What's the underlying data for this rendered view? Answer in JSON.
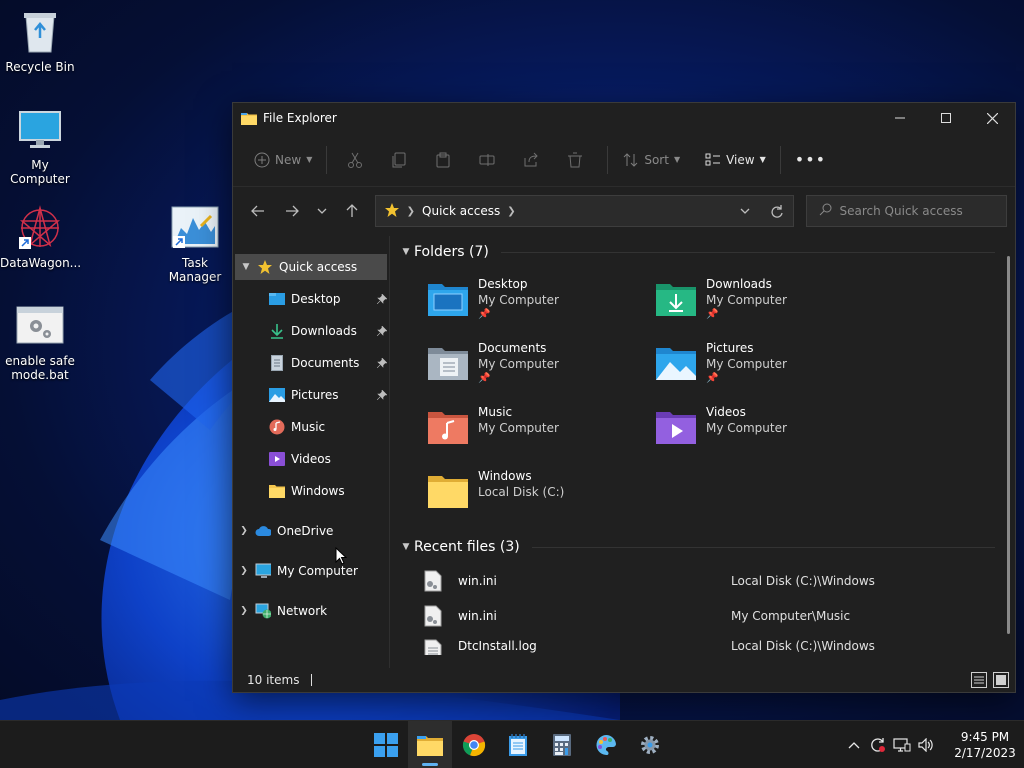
{
  "desktop": {
    "icons": [
      {
        "label": "Recycle Bin"
      },
      {
        "label": "My Computer"
      },
      {
        "label": "DataWagon..."
      },
      {
        "label": "Task Manager"
      },
      {
        "label": "enable safe mode.bat"
      }
    ]
  },
  "window": {
    "title": "File Explorer",
    "toolbar": {
      "new_label": "New",
      "sort_label": "Sort",
      "view_label": "View"
    },
    "address": {
      "crumb": "Quick access"
    },
    "search_placeholder": "Search Quick access",
    "sidebar": {
      "quick_access": "Quick access",
      "pinned": [
        "Desktop",
        "Downloads",
        "Documents",
        "Pictures"
      ],
      "others": [
        "Music",
        "Videos",
        "Windows"
      ],
      "onedrive": "OneDrive",
      "my_computer": "My Computer",
      "network": "Network"
    },
    "folders_header": "Folders (7)",
    "folders": [
      {
        "name": "Desktop",
        "loc": "My Computer"
      },
      {
        "name": "Downloads",
        "loc": "My Computer"
      },
      {
        "name": "Documents",
        "loc": "My Computer"
      },
      {
        "name": "Pictures",
        "loc": "My Computer"
      },
      {
        "name": "Music",
        "loc": "My Computer"
      },
      {
        "name": "Videos",
        "loc": "My Computer"
      },
      {
        "name": "Windows",
        "loc": "Local Disk (C:)"
      }
    ],
    "recent_header": "Recent files (3)",
    "recent": [
      {
        "name": "win.ini",
        "path": "Local Disk (C:)\\Windows"
      },
      {
        "name": "win.ini",
        "path": "My Computer\\Music"
      },
      {
        "name": "DtcInstall.log",
        "path": "Local Disk (C:)\\Windows"
      }
    ],
    "status": "10 items"
  },
  "taskbar": {
    "time": "9:45 PM",
    "date": "2/17/2023"
  },
  "colors": {
    "accent": "#5fb2f2",
    "window_bg": "#202020",
    "selection": "#4a4a4a"
  }
}
